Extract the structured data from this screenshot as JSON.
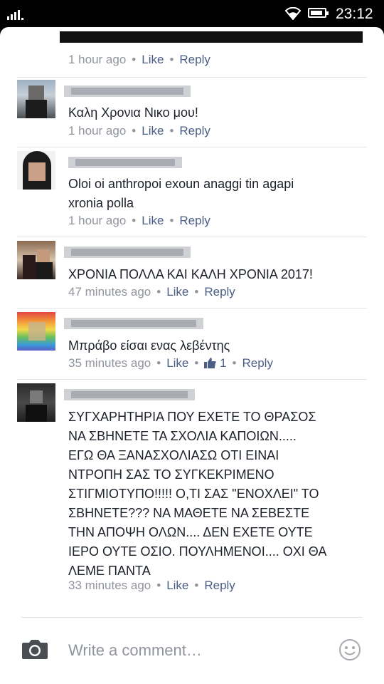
{
  "status_bar": {
    "time": "23:12"
  },
  "comments": [
    {
      "text": "",
      "time": "1 hour ago",
      "like": "Like",
      "reply": "Reply"
    },
    {
      "text": "Καλη Χρονια Νικο μου!",
      "time": "1 hour ago",
      "like": "Like",
      "reply": "Reply"
    },
    {
      "text_lines": [
        "Oloi oi  anthropoi exoun anaggi tin agapi",
        "xronia polla"
      ],
      "time": "1 hour ago",
      "like": "Like",
      "reply": "Reply"
    },
    {
      "text": "ΧΡΟΝΙΑ ΠΟΛΛΑ ΚΑΙ ΚΑΛΗ ΧΡΟΝΙΑ 2017!",
      "time": "47 minutes ago",
      "like": "Like",
      "reply": "Reply"
    },
    {
      "text": "Μπράβο είσαι ενας λεβέντης",
      "time": "35 minutes ago",
      "like": "Like",
      "like_count": "1",
      "reply": "Reply"
    },
    {
      "text_lines": [
        "ΣΥΓΧΑΡΗΤΗΡΙΑ ΠΟΥ ΕΧΕΤΕ ΤΟ ΘΡΑΣΟΣ",
        "ΝΑ ΣΒΗΝΕΤΕ ΤΑ ΣΧΟΛΙΑ  ΚΑΠΟΙΩΝ.....",
        "ΕΓΩ ΘΑ ΞΑΝΑΣΧΟΛΙΑΣΩ ΟΤΙ ΕΙΝΑΙ",
        "ΝΤΡΟΠΗ ΣΑΣ ΤΟ ΣΥΓΚΕΚΡΙΜΕΝΟ",
        "ΣΤΙΓΜΙΟΤΥΠΟ!!!!! Ο,ΤΙ ΣΑΣ \"ΕΝΟΧΛΕΙ\" ΤΟ",
        "ΣΒΗΝΕΤΕ??? ΝΑ ΜΑΘΕΤΕ ΝΑ ΣΕΒΕΣΤΕ",
        "ΤΗΝ ΑΠΟΨΗ ΟΛΩΝ.... ΔΕΝ ΕΧΕΤΕ ΟΥΤΕ",
        "ΙΕΡΟ ΟΥΤΕ ΟΣΙΟ. ΠΟΥΛΗΜΕΝΟΙ.... ΟΧΙ ΘΑ",
        "ΛΕΜΕ ΠΑΝΤΑ"
      ],
      "time": "33 minutes ago",
      "like": "Like",
      "reply": "Reply"
    }
  ],
  "composer": {
    "placeholder": "Write a comment…"
  },
  "icons": {
    "camera": "camera-icon",
    "emoji": "emoji-icon",
    "like": "thumbs-up-icon"
  },
  "colors": {
    "link": "#4b5e86",
    "meta": "#90949c",
    "text": "#1d2129"
  }
}
